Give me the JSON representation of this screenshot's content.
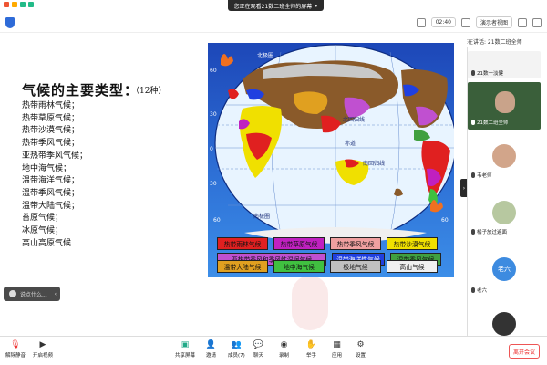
{
  "window": {
    "banner_title": "您正在观看21数二班全师的屏幕",
    "time": "02:40",
    "view_button": "演示者视图",
    "page_indicator": "1",
    "speaker_label": "正在讲话: 21数二班全师"
  },
  "slide": {
    "title": "气候的主要类型：",
    "count": "（12种）",
    "climates": [
      "热带雨林气候；",
      "热带草原气候；",
      "热带沙漠气候；",
      "热带季风气候；",
      "亚热带季风气候；",
      "地中海气候；",
      "温带海洋气候；",
      "温带季风气候；",
      "温带大陆气候；",
      "苔原气候；",
      "冰原气候；",
      "高山高原气候"
    ],
    "map_labels": {
      "arctic": "北极圈",
      "tropic_cancer": "北回归线",
      "equator": "赤道",
      "tropic_capricorn": "南回归线",
      "antarctic": "南极圈",
      "lat_60n": "60",
      "lat_30n": "30",
      "lat_0": "0",
      "lat_30s": "30",
      "lat_60s": "60",
      "lat_60s_right": "60"
    },
    "legend": [
      [
        {
          "label": "热带雨林气候",
          "color": "#e02020"
        },
        {
          "label": "热带草原气候",
          "color": "#c020c0"
        },
        {
          "label": "热带季风气候",
          "color": "#f0a0a0"
        },
        {
          "label": "热带沙漠气候",
          "color": "#f0e000"
        }
      ],
      [
        {
          "label": "亚热带季风和季风性湿润气候",
          "color": "#c050d0"
        },
        {
          "label": "温带海洋性气候",
          "color": "#2040e0"
        },
        {
          "label": "温带季风气候",
          "color": "#40a040"
        }
      ],
      [
        {
          "label": "温带大陆气候",
          "color": "#e0a020"
        },
        {
          "label": "地中海气候",
          "color": "#40c040"
        },
        {
          "label": "极地气候",
          "color": "#c0c0c0"
        },
        {
          "label": "高山气候",
          "color": "#f0f0f0"
        }
      ]
    ]
  },
  "comment": {
    "placeholder": "说点什么..."
  },
  "participants": [
    {
      "name": "21数一淡健"
    },
    {
      "name": "21数二班全师"
    },
    {
      "name": "韦老师"
    },
    {
      "name": "橘子放过遍面"
    },
    {
      "name": "老六",
      "avatar_text": "老六"
    },
    {
      "name": ""
    }
  ],
  "bottombar": {
    "mute": "解除静音",
    "video": "开启视频",
    "share": "共享屏幕",
    "invite": "邀请",
    "members": "成员(7)",
    "chat": "聊天",
    "record": "录制",
    "raise_hand": "举手",
    "apps": "应用",
    "settings": "设置",
    "leave": "离开会议"
  },
  "colors": {
    "ocean": "#2f73d8",
    "land_brown": "#8a5a2a",
    "leave_red": "#e33333"
  }
}
